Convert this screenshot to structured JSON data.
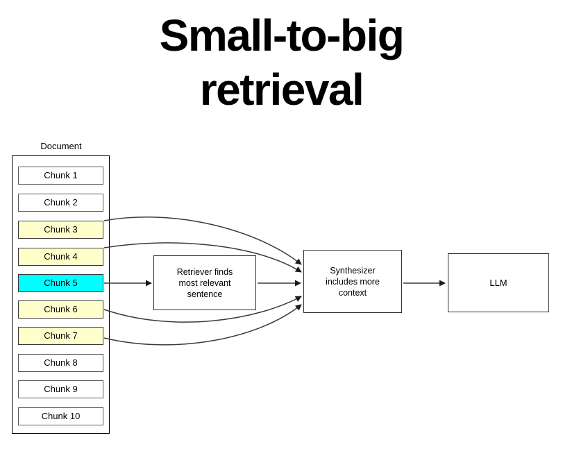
{
  "slide": {
    "title": "Small-to-big\nretrieval",
    "background_color": "#ffffff"
  },
  "diagram": {
    "document": {
      "label": "Document",
      "chunks": [
        {
          "label": "Chunk 1",
          "highlight": "none",
          "color": "#ffffff"
        },
        {
          "label": "Chunk 2",
          "highlight": "none",
          "color": "#ffffff"
        },
        {
          "label": "Chunk 3",
          "highlight": "yellow",
          "color": "#ffffcc"
        },
        {
          "label": "Chunk 4",
          "highlight": "yellow",
          "color": "#ffffcc"
        },
        {
          "label": "Chunk 5",
          "highlight": "cyan",
          "color": "#00ffff"
        },
        {
          "label": "Chunk 6",
          "highlight": "yellow",
          "color": "#ffffcc"
        },
        {
          "label": "Chunk 7",
          "highlight": "yellow",
          "color": "#ffffcc"
        },
        {
          "label": "Chunk 8",
          "highlight": "none",
          "color": "#ffffff"
        },
        {
          "label": "Chunk 9",
          "highlight": "none",
          "color": "#ffffff"
        },
        {
          "label": "Chunk 10",
          "highlight": "none",
          "color": "#ffffff"
        }
      ]
    },
    "nodes": {
      "retriever": "Retriever finds\nmost relevant\nsentence",
      "synthesizer": "Synthesizer\nincludes more\ncontext",
      "llm": "LLM"
    },
    "edges": [
      {
        "from": "Chunk 5",
        "to": "retriever",
        "style": "straight"
      },
      {
        "from": "retriever",
        "to": "synthesizer",
        "style": "straight"
      },
      {
        "from": "Chunk 3",
        "to": "synthesizer",
        "style": "curved"
      },
      {
        "from": "Chunk 4",
        "to": "synthesizer",
        "style": "curved"
      },
      {
        "from": "Chunk 6",
        "to": "synthesizer",
        "style": "curved"
      },
      {
        "from": "Chunk 7",
        "to": "synthesizer",
        "style": "curved"
      },
      {
        "from": "synthesizer",
        "to": "llm",
        "style": "straight"
      }
    ],
    "stroke_color": "#2b2b2b"
  }
}
